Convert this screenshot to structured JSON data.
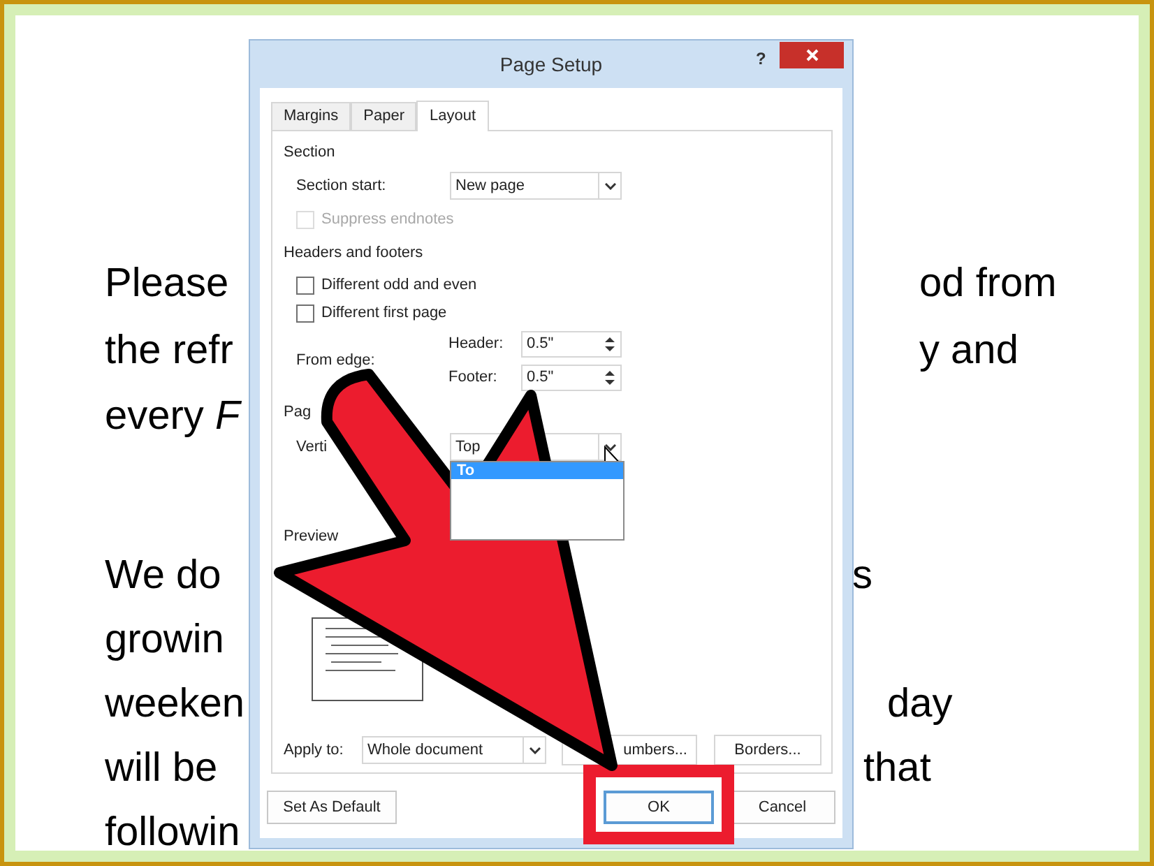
{
  "document": {
    "paragraphs": [
      {
        "lines": [
          {
            "left": "Please",
            "right": "od from"
          },
          {
            "left": "the refr",
            "right": "y and"
          },
          {
            "left": "every *F*"
          }
        ]
      },
      {
        "lines": [
          {
            "left": "We do",
            "right": "s"
          },
          {
            "left": "growin"
          },
          {
            "left": "weeken",
            "right": "day"
          },
          {
            "left": "will be",
            "right": "that"
          },
          {
            "left": "followin"
          }
        ]
      }
    ]
  },
  "dialog": {
    "title": "Page Setup",
    "help_button": "?",
    "tabs": [
      {
        "label": "Margins",
        "selected": false
      },
      {
        "label": "Paper",
        "selected": false
      },
      {
        "label": "Layout",
        "selected": true
      }
    ],
    "section": {
      "heading": "Section",
      "start_label": "Section start:",
      "start_value": "New page",
      "suppress": {
        "label": "Suppress endnotes",
        "checked": false,
        "disabled": true
      }
    },
    "headers_footers": {
      "heading": "Headers and footers",
      "options": [
        {
          "label": "Different odd and even",
          "checked": false,
          "disabled": false
        },
        {
          "label": "Different first page",
          "checked": false,
          "disabled": false
        }
      ],
      "from_edge": "From edge:",
      "header_label": "Header:",
      "header_value": "0.5\"",
      "footer_label": "Footer:",
      "footer_value": "0.5\""
    },
    "page": {
      "heading": "Pag",
      "vertical_label": "Verti",
      "vertical_value": "Top",
      "options": [
        {
          "label": "To",
          "selected": true
        }
      ]
    },
    "preview": {
      "heading": "Preview"
    },
    "apply_label": "Apply to:",
    "apply_value": "Whole document",
    "line_numbers": "umbers...",
    "borders": "Borders...",
    "buttons": [
      {
        "label": "Set As Default",
        "focused": false
      },
      {
        "label": "OK",
        "focused": true
      },
      {
        "label": "Cancel",
        "focused": false
      }
    ]
  }
}
